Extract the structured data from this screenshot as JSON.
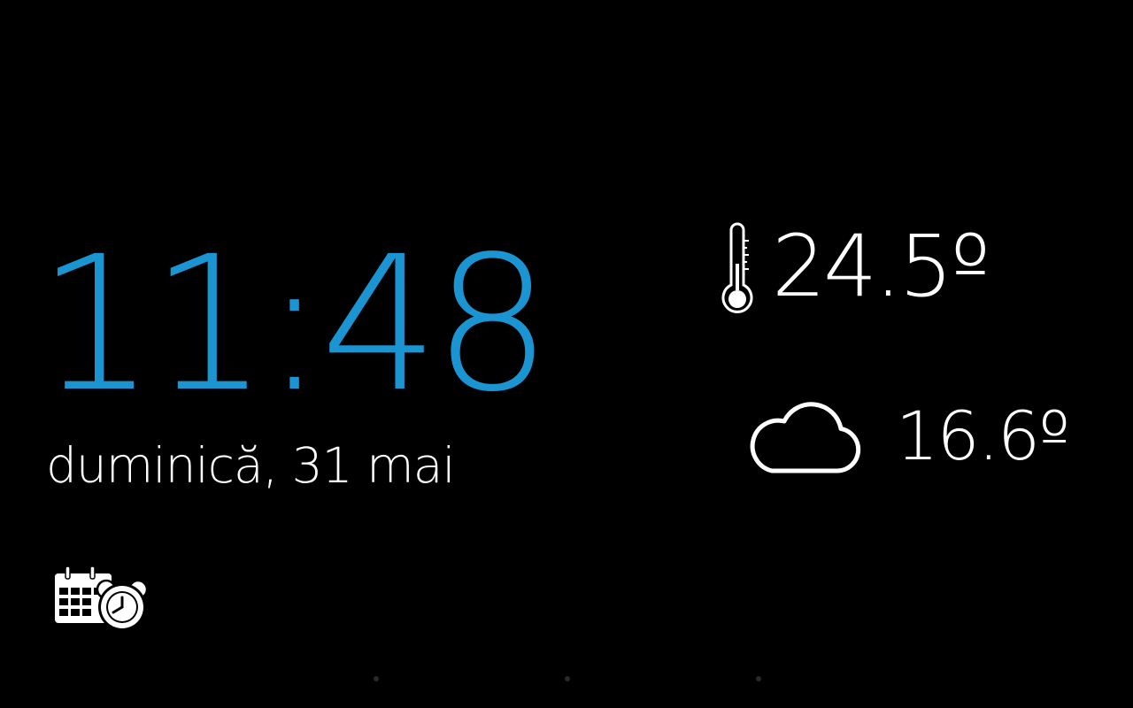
{
  "clock": {
    "time": "11:48",
    "color": "#1a95d2"
  },
  "date": {
    "text": "duminică, 31 mai"
  },
  "weather": {
    "indoor_temp": "24.5º",
    "outdoor_temp": "16.6º",
    "indoor_icon": "thermometer-icon",
    "outdoor_icon": "cloud-icon"
  },
  "shortcuts": {
    "alarm_icon": "calendar-alarm-icon"
  },
  "pager": {
    "page_count": 3
  }
}
